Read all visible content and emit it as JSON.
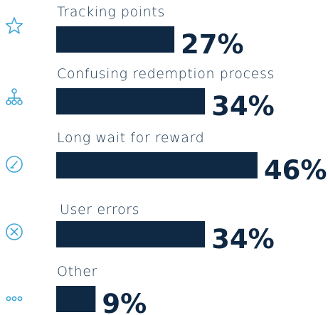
{
  "chart_data": {
    "type": "bar",
    "orientation": "horizontal",
    "categories": [
      "Tracking points",
      "Confusing redemption process",
      "Long wait for reward",
      "User errors",
      "Other"
    ],
    "values": [
      27,
      34,
      46,
      34,
      9
    ],
    "value_labels": [
      "27%",
      "34%",
      "46%",
      "34%",
      "9%"
    ],
    "unit": "%",
    "icons": [
      "star-icon",
      "sitemap-icon",
      "gauge-icon",
      "x-circle-icon",
      "ellipsis-icon"
    ],
    "colors": {
      "bar": "#0f2843",
      "label": "#1a3550",
      "icon": "#3fa6d6"
    },
    "title": "",
    "xlabel": "",
    "ylabel": ""
  }
}
